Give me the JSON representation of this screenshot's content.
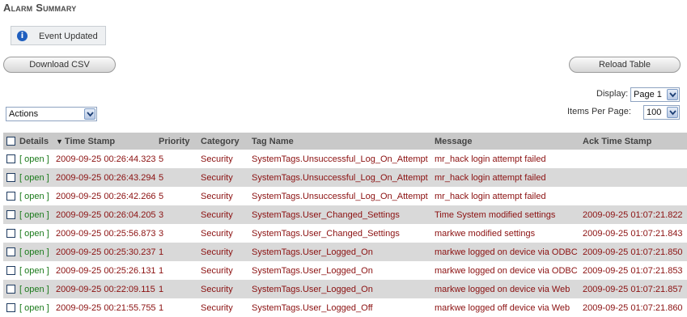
{
  "page": {
    "title": "Alarm Summary"
  },
  "notice": {
    "icon": "info-icon",
    "text": "Event Updated"
  },
  "toolbar": {
    "download_label": "Download CSV",
    "reload_label": "Reload Table"
  },
  "actions_select": {
    "value": "Actions"
  },
  "paging": {
    "display_label": "Display:",
    "display_value": "Page 1",
    "items_label": "Items Per Page:",
    "items_value": "100"
  },
  "table": {
    "columns": [
      "Details",
      "Time Stamp",
      "Priority",
      "Category",
      "Tag Name",
      "Message",
      "Ack Time Stamp"
    ],
    "sorted_column": "Time Stamp",
    "rows": [
      {
        "details": "[ open ]",
        "time": "2009-09-25 00:26:44.323",
        "priority": "5",
        "category": "Security",
        "tag": "SystemTags.Unsuccessful_Log_On_Attempt",
        "message": "mr_hack login attempt failed",
        "ack": ""
      },
      {
        "details": "[ open ]",
        "time": "2009-09-25 00:26:43.294",
        "priority": "5",
        "category": "Security",
        "tag": "SystemTags.Unsuccessful_Log_On_Attempt",
        "message": "mr_hack login attempt failed",
        "ack": ""
      },
      {
        "details": "[ open ]",
        "time": "2009-09-25 00:26:42.266",
        "priority": "5",
        "category": "Security",
        "tag": "SystemTags.Unsuccessful_Log_On_Attempt",
        "message": "mr_hack login attempt failed",
        "ack": ""
      },
      {
        "details": "[ open ]",
        "time": "2009-09-25 00:26:04.205",
        "priority": "3",
        "category": "Security",
        "tag": "SystemTags.User_Changed_Settings",
        "message": "Time System modified settings",
        "ack": "2009-09-25 01:07:21.822"
      },
      {
        "details": "[ open ]",
        "time": "2009-09-25 00:25:56.873",
        "priority": "3",
        "category": "Security",
        "tag": "SystemTags.User_Changed_Settings",
        "message": "markwe modified settings",
        "ack": "2009-09-25 01:07:21.843"
      },
      {
        "details": "[ open ]",
        "time": "2009-09-25 00:25:30.237",
        "priority": "1",
        "category": "Security",
        "tag": "SystemTags.User_Logged_On",
        "message": "markwe logged on device via ODBC",
        "ack": "2009-09-25 01:07:21.850"
      },
      {
        "details": "[ open ]",
        "time": "2009-09-25 00:25:26.131",
        "priority": "1",
        "category": "Security",
        "tag": "SystemTags.User_Logged_On",
        "message": "markwe logged on device via ODBC",
        "ack": "2009-09-25 01:07:21.853"
      },
      {
        "details": "[ open ]",
        "time": "2009-09-25 00:22:09.115",
        "priority": "1",
        "category": "Security",
        "tag": "SystemTags.User_Logged_On",
        "message": "markwe logged on device via Web",
        "ack": "2009-09-25 01:07:21.857"
      },
      {
        "details": "[ open ]",
        "time": "2009-09-25 00:21:55.755",
        "priority": "1",
        "category": "Security",
        "tag": "SystemTags.User_Logged_Off",
        "message": "markwe logged off device via Web",
        "ack": "2009-09-25 01:07:21.860"
      }
    ]
  },
  "colors": {
    "header_bg": "#c9c9c9",
    "row_shade": "#d9d9d9",
    "value_text": "#8b1010",
    "link_text": "#1a7a1a"
  }
}
